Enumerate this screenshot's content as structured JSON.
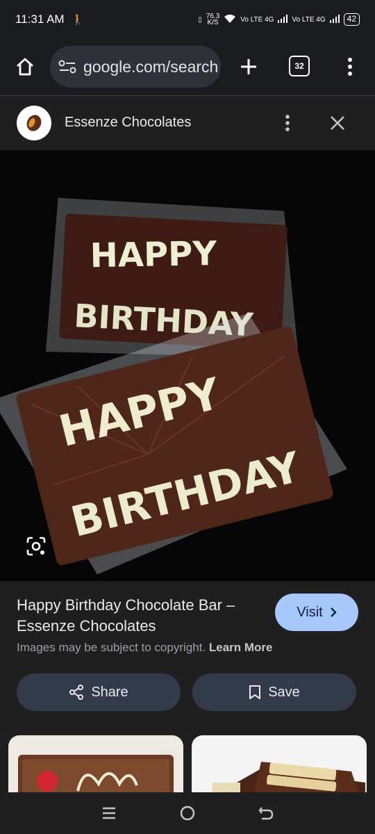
{
  "status": {
    "time": "11:31 AM",
    "speed": "76.3",
    "speed_unit": "K/S",
    "net1": "Vo LTE 4G",
    "net2": "Vo LTE 4G",
    "battery": "42"
  },
  "toolbar": {
    "url": "google.com/search",
    "tab_count": "32"
  },
  "source": {
    "name": "Essenze Chocolates"
  },
  "image": {
    "alt": "Two Happy Birthday chocolate bars in clear wrapping",
    "text_happy": "HAPPY",
    "text_birthday": "BIRTHDAY"
  },
  "info": {
    "title": "Happy Birthday Chocolate Bar – Essenze Chocolates",
    "visit_label": "Visit",
    "copyright_text": "Images may be subject to copyright.",
    "learn_more": "Learn More",
    "share_label": "Share",
    "save_label": "Save"
  },
  "colors": {
    "visit_bg": "#a8c7fa",
    "button_bg": "#333b4a",
    "background": "#1f1f1f"
  }
}
